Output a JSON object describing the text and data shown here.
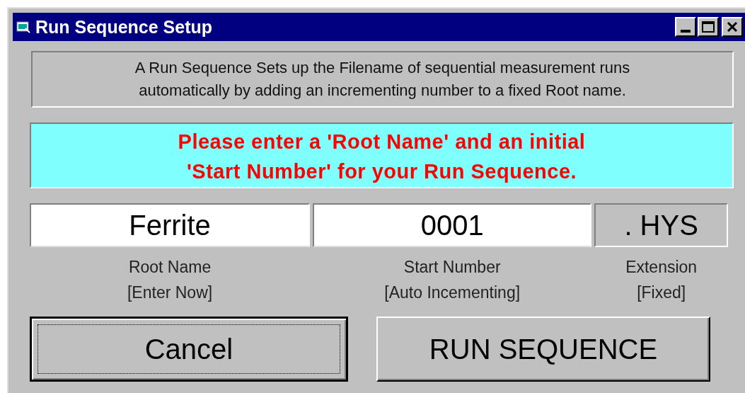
{
  "window": {
    "title": "Run Sequence Setup"
  },
  "description": "A Run Sequence Sets up the Filename of sequential measurement runs\nautomatically by adding an incrementing number to a fixed Root name.",
  "prompt": "Please enter a 'Root Name' and an initial\n'Start Number' for your Run Sequence.",
  "fields": [
    {
      "kind": "input",
      "value": "Ferrite",
      "label": "Root Name",
      "hint": "[Enter Now]"
    },
    {
      "kind": "input",
      "value": "0001",
      "label": "Start Number",
      "hint": "[Auto Incementing]"
    },
    {
      "kind": "readonly",
      "value": ". HYS",
      "label": "Extension",
      "hint": "[Fixed]"
    }
  ],
  "buttons": [
    {
      "label": "Cancel",
      "default": true
    },
    {
      "label": "RUN SEQUENCE",
      "default": false
    }
  ]
}
